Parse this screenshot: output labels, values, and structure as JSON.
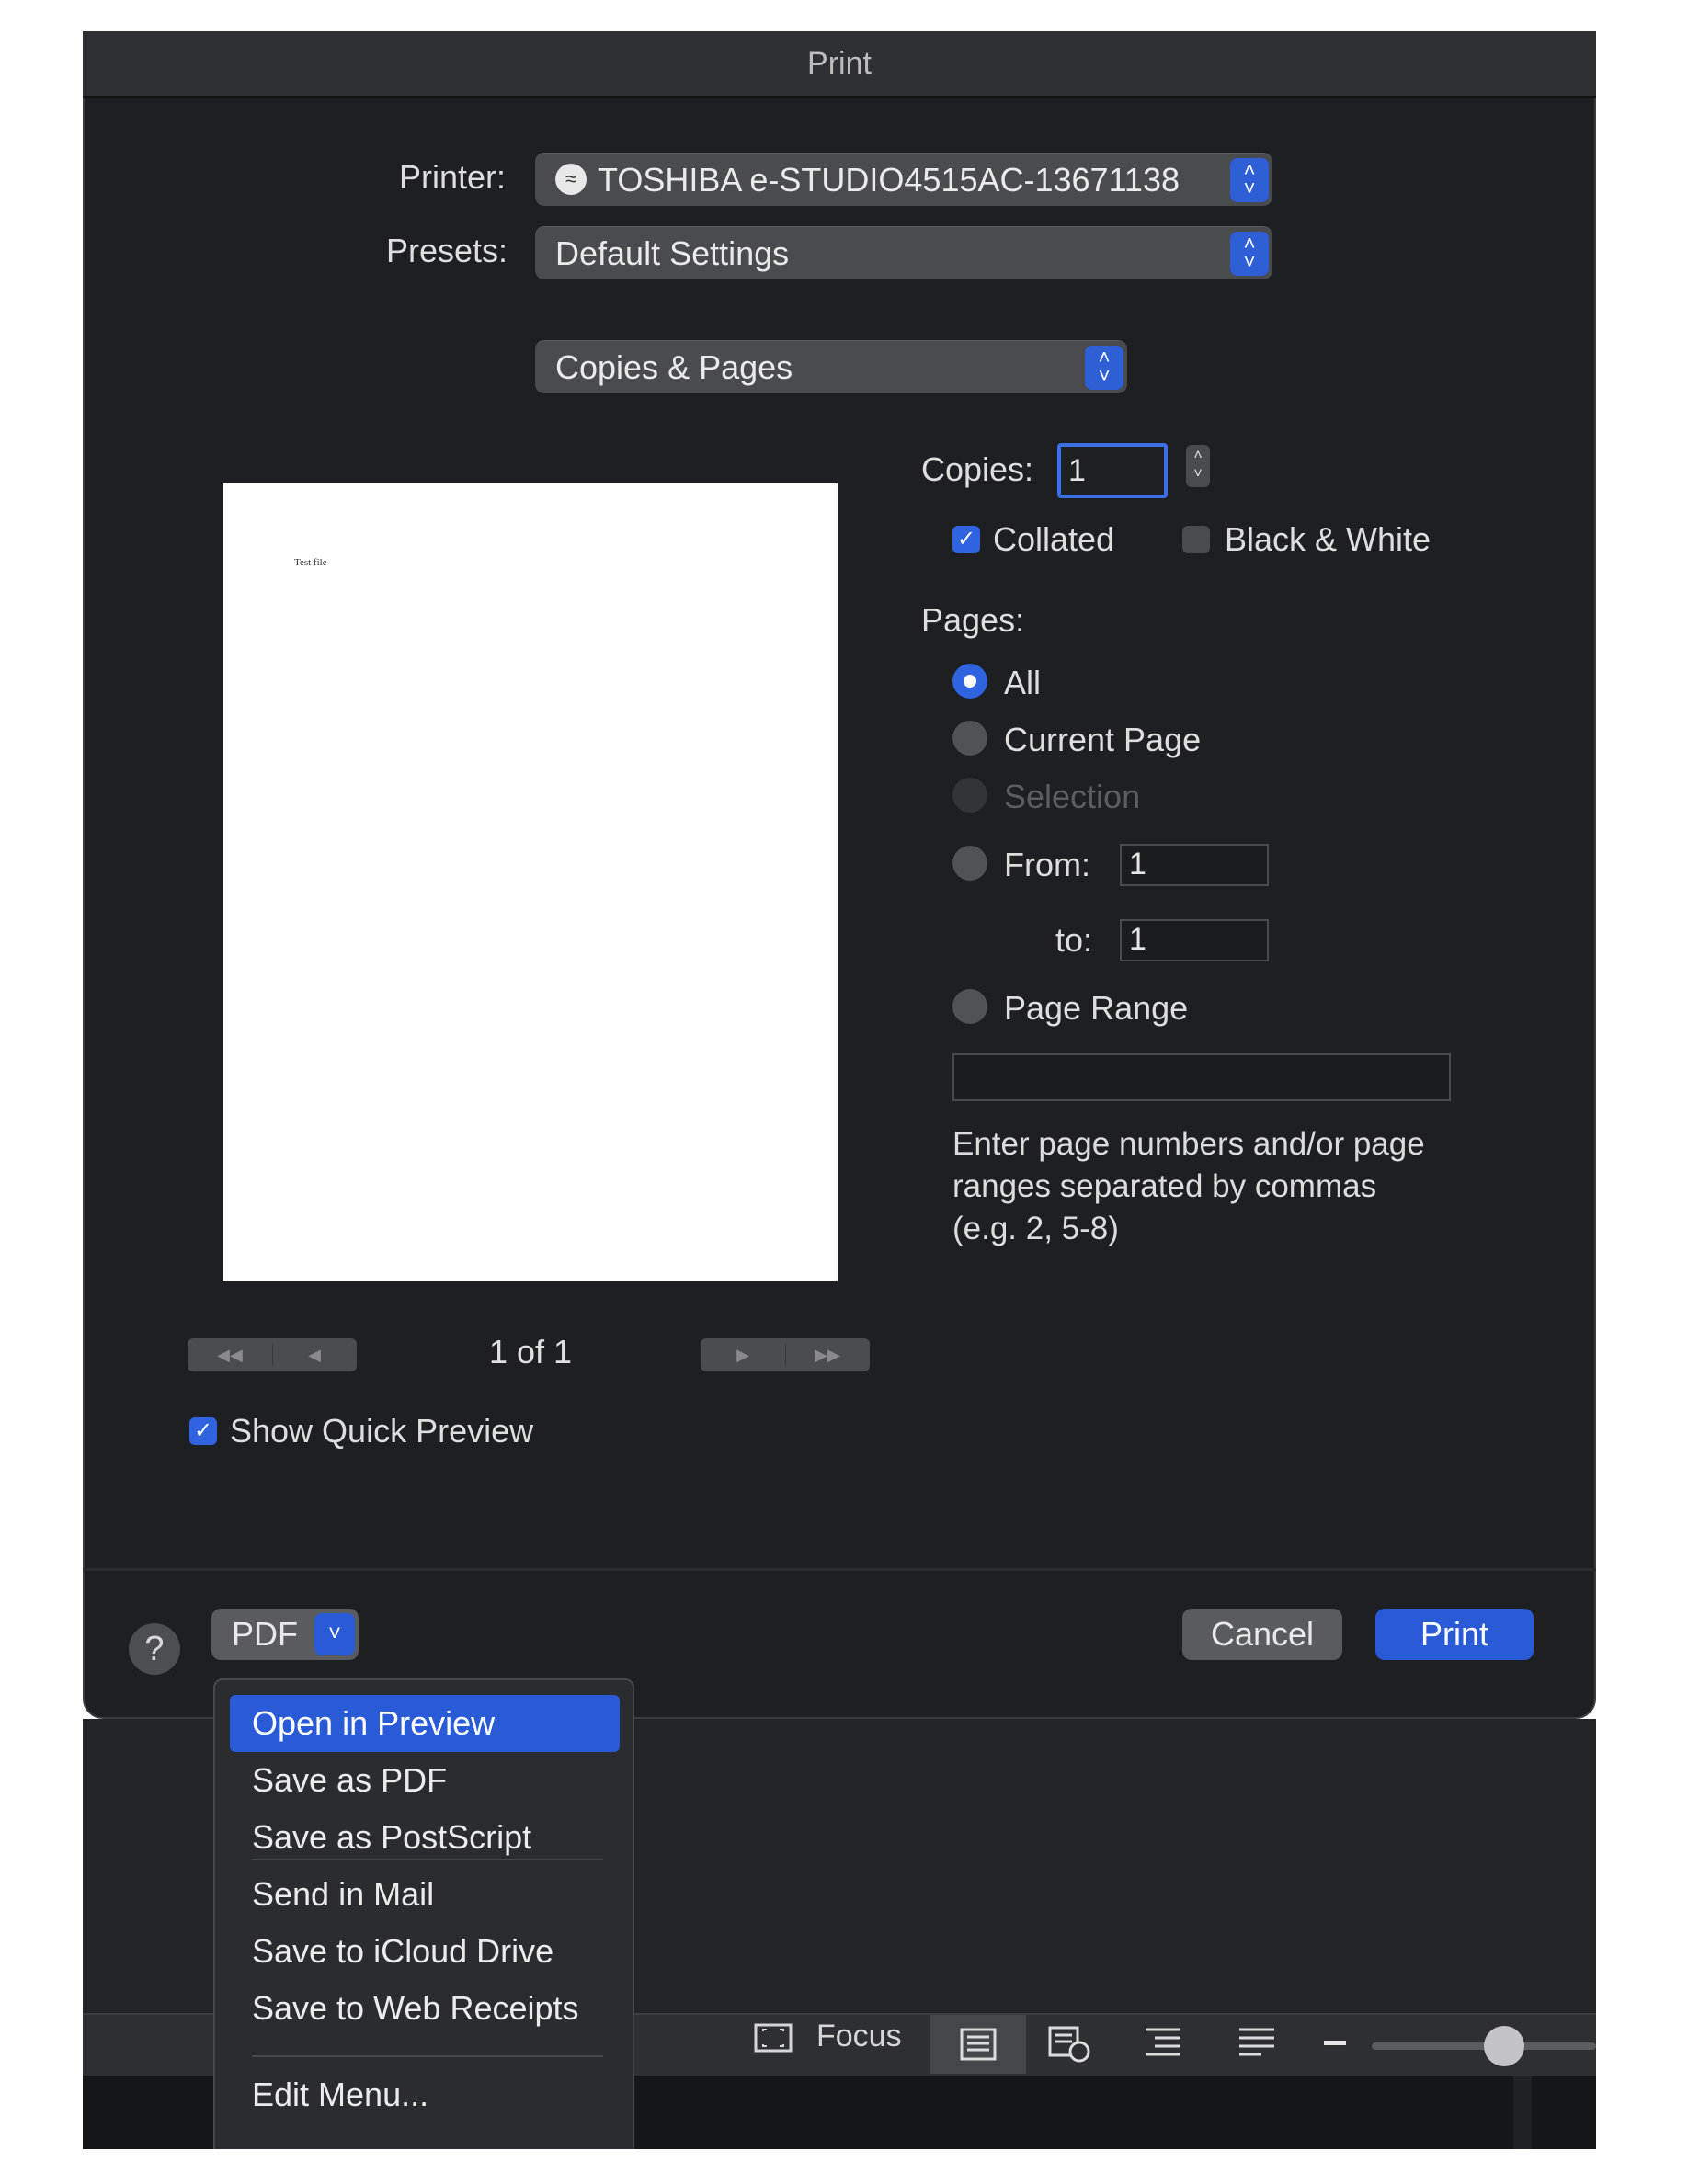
{
  "window": {
    "title": "Print"
  },
  "printer": {
    "label": "Printer:",
    "value": "TOSHIBA e-STUDIO4515AC-13671138"
  },
  "presets": {
    "label": "Presets:",
    "value": "Default Settings"
  },
  "section": {
    "value": "Copies & Pages"
  },
  "copies": {
    "label": "Copies:",
    "value": "1"
  },
  "collated": {
    "label": "Collated",
    "checked": true
  },
  "black_white": {
    "label": "Black & White",
    "checked": false
  },
  "pages": {
    "label": "Pages:",
    "options": [
      "All",
      "Current Page",
      "Selection",
      "From:",
      "Page Range"
    ],
    "selected": "All",
    "from_value": "1",
    "to_label": "to:",
    "to_value": "1",
    "range_value": "",
    "hint": "Enter page numbers and/or page ranges separated by commas (e.g. 2, 5-8)"
  },
  "preview": {
    "doc_text": "Test file",
    "page_indicator": "1 of 1"
  },
  "quick_preview": {
    "label": "Show Quick Preview",
    "checked": true
  },
  "footer": {
    "help": "?",
    "pdf_label": "PDF",
    "cancel_label": "Cancel",
    "print_label": "Print"
  },
  "pdf_menu": {
    "items": [
      "Open in Preview",
      "Save as PDF",
      "Save as PostScript",
      "Send in Mail",
      "Save to iCloud Drive",
      "Save to Web Receipts",
      "Edit Menu..."
    ],
    "selected": "Open in Preview"
  },
  "background_toolbar": {
    "focus_label": "Focus"
  },
  "colors": {
    "accent": "#2a5bd7",
    "window_bg": "#1e1f23",
    "control_bg": "#4a4b4f"
  }
}
